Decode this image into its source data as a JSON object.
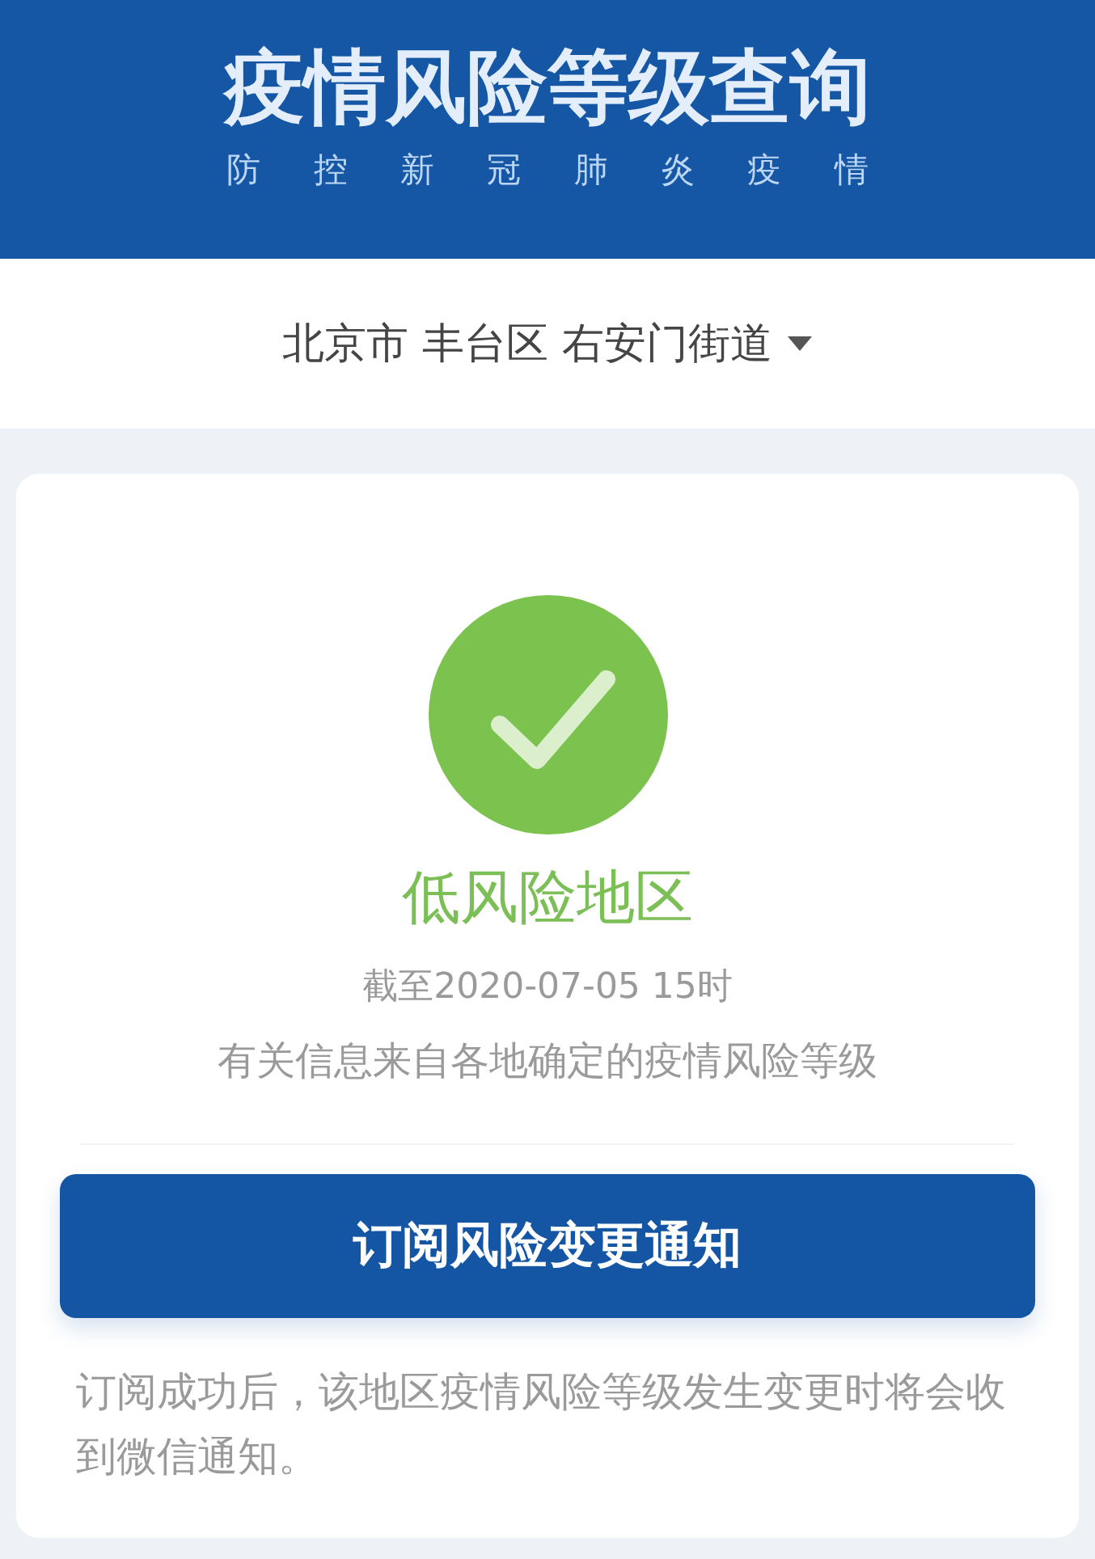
{
  "header": {
    "title": "疫情风险等级查询",
    "subtitle": "防 控 新 冠 肺 炎 疫 情"
  },
  "location": {
    "value": "北京市 丰台区 右安门街道"
  },
  "risk": {
    "kind": "low",
    "label": "低风险地区",
    "updated": "截至2020-07-05 15时",
    "source": "有关信息来自各地确定的疫情风险等级"
  },
  "subscribe": {
    "button": "订阅风险变更通知",
    "note": "订阅成功后，该地区疫情风险等级发生变更时将会收到微信通知。"
  }
}
